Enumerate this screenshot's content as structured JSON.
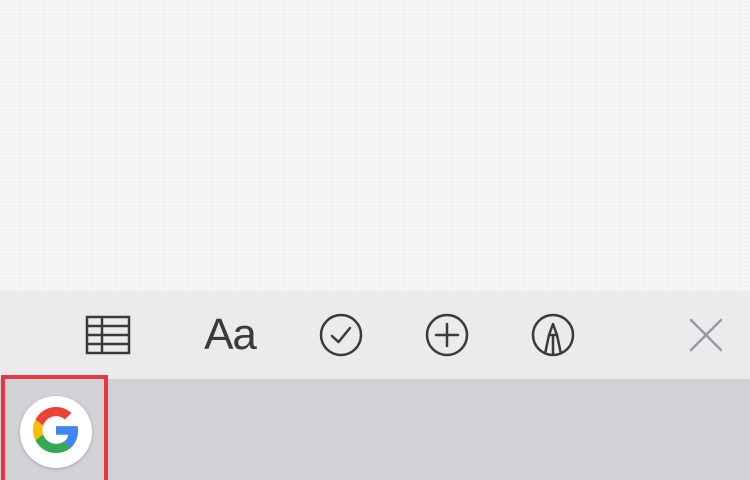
{
  "toolbar": {
    "table_icon": "table-icon",
    "format_label": "Aa",
    "checklist_icon": "checkmark-circle-icon",
    "add_icon": "plus-circle-icon",
    "markup_icon": "pen-circle-icon",
    "close_icon": "close-icon"
  },
  "keyboard": {
    "app_icon": "google-logo-icon"
  },
  "colors": {
    "note_background": "#f5f5f4",
    "toolbar_background": "#ebebed",
    "keyboard_background": "#d1d2d6",
    "icon_color": "#3a3a3c",
    "close_icon_color": "#9a9a9e",
    "highlight": "#e8383d",
    "google_blue": "#4285F4",
    "google_red": "#EA4335",
    "google_yellow": "#FBBC05",
    "google_green": "#34A853"
  }
}
